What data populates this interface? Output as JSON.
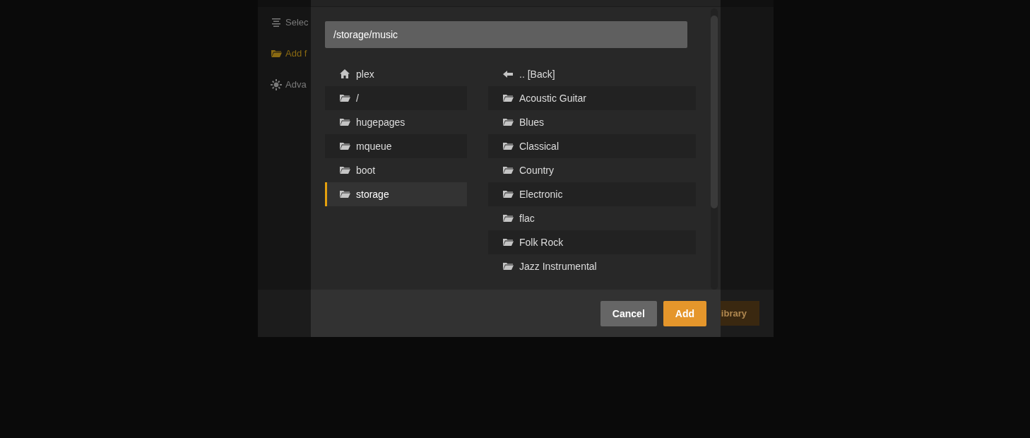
{
  "background_panel": {
    "sidebar": [
      {
        "label": "Selec",
        "kind": "list",
        "selected": false
      },
      {
        "label": "Add f",
        "kind": "folder",
        "selected": true
      },
      {
        "label": "Adva",
        "kind": "gear",
        "selected": false
      }
    ],
    "footer_button": "ibrary"
  },
  "dialog": {
    "path": "/storage/music",
    "places": [
      {
        "label": "plex",
        "kind": "home",
        "selected": false
      },
      {
        "label": "/",
        "kind": "folder",
        "selected": false
      },
      {
        "label": "hugepages",
        "kind": "folder",
        "selected": false
      },
      {
        "label": "mqueue",
        "kind": "folder",
        "selected": false
      },
      {
        "label": "boot",
        "kind": "folder",
        "selected": false
      },
      {
        "label": "storage",
        "kind": "folder",
        "selected": true
      }
    ],
    "folders": [
      {
        "label": ".. [Back]",
        "kind": "back"
      },
      {
        "label": "Acoustic Guitar",
        "kind": "folder"
      },
      {
        "label": "Blues",
        "kind": "folder"
      },
      {
        "label": "Classical",
        "kind": "folder"
      },
      {
        "label": "Country",
        "kind": "folder"
      },
      {
        "label": "Electronic",
        "kind": "folder"
      },
      {
        "label": "flac",
        "kind": "folder"
      },
      {
        "label": "Folk Rock",
        "kind": "folder"
      },
      {
        "label": "Jazz Instrumental",
        "kind": "folder"
      }
    ],
    "buttons": [
      {
        "label": "Cancel",
        "kind": "secondary"
      },
      {
        "label": "Add",
        "kind": "primary"
      }
    ]
  }
}
